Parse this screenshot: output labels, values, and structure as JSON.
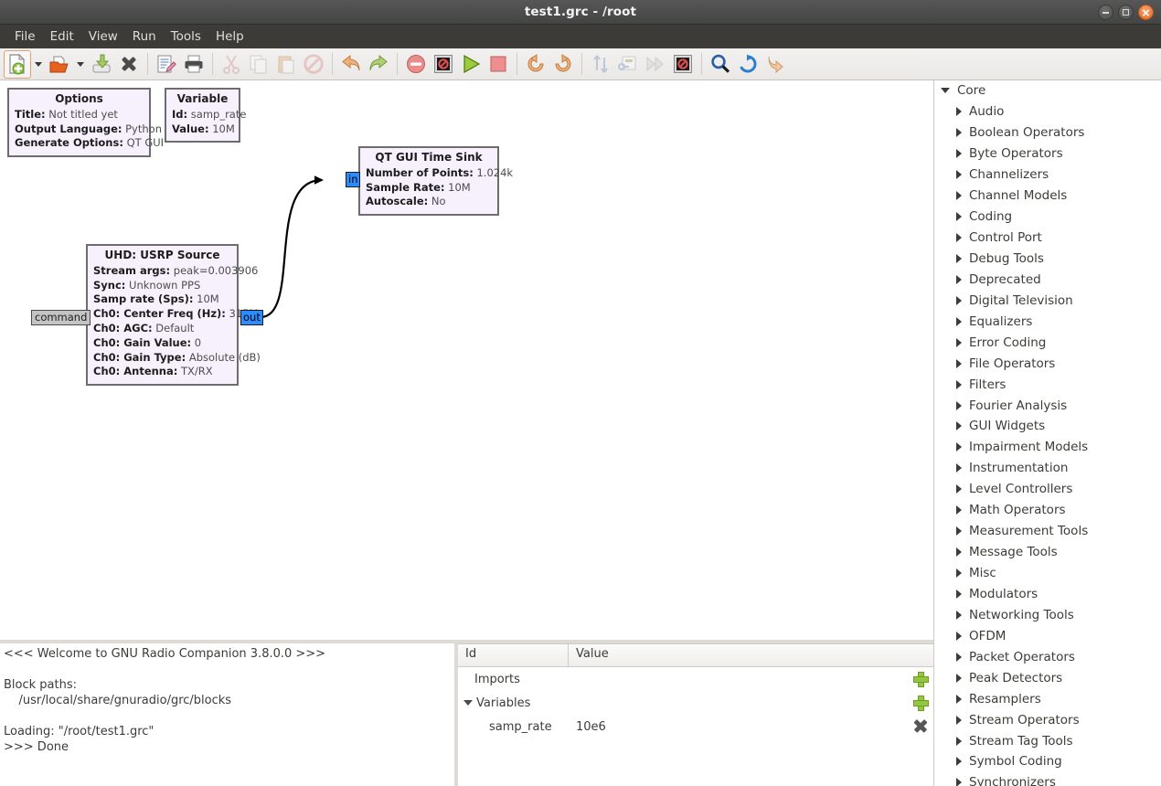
{
  "window": {
    "title": "test1.grc - /root",
    "controls": {
      "minimize": "minimize-button",
      "maximize": "maximize-button",
      "close": "close-button"
    }
  },
  "menubar": {
    "items": [
      "File",
      "Edit",
      "View",
      "Run",
      "Tools",
      "Help"
    ]
  },
  "toolbar": {
    "groups": [
      [
        {
          "name": "new-flowgraph",
          "icon": "new-document-icon",
          "selected": true,
          "enabled": true
        },
        {
          "name": "new-dropdown",
          "icon": "chevron-down-icon",
          "enabled": true
        },
        {
          "name": "open-flowgraph",
          "icon": "open-folder-icon",
          "enabled": true
        },
        {
          "name": "open-dropdown",
          "icon": "chevron-down-icon",
          "enabled": true
        },
        {
          "name": "save-flowgraph",
          "icon": "save-disk-icon",
          "enabled": true
        },
        {
          "name": "close-flowgraph",
          "icon": "close-x-icon",
          "enabled": true
        }
      ],
      [
        {
          "name": "edit-properties",
          "icon": "edit-pencil-icon",
          "enabled": true
        },
        {
          "name": "print",
          "icon": "printer-icon",
          "enabled": true
        }
      ],
      [
        {
          "name": "cut",
          "icon": "scissors-icon",
          "enabled": false
        },
        {
          "name": "copy",
          "icon": "copy-icon",
          "enabled": false
        },
        {
          "name": "paste",
          "icon": "paste-icon",
          "enabled": false
        },
        {
          "name": "delete",
          "icon": "no-entry-icon",
          "enabled": false
        }
      ],
      [
        {
          "name": "undo",
          "icon": "undo-arrow-icon",
          "enabled": true
        },
        {
          "name": "redo",
          "icon": "redo-arrow-icon",
          "enabled": true
        }
      ],
      [
        {
          "name": "errors",
          "icon": "error-circle-icon",
          "enabled": true
        },
        {
          "name": "generate",
          "icon": "generate-icon",
          "enabled": true
        },
        {
          "name": "execute-flowgraph",
          "icon": "play-icon",
          "enabled": true
        },
        {
          "name": "kill-flowgraph",
          "icon": "stop-square-icon",
          "enabled": true
        }
      ],
      [
        {
          "name": "rotate-left",
          "icon": "rotate-ccw-icon",
          "enabled": true
        },
        {
          "name": "rotate-right",
          "icon": "rotate-cw-icon",
          "enabled": true
        }
      ],
      [
        {
          "name": "toggle-source-sink",
          "icon": "updown-arrows-icon",
          "enabled": false
        },
        {
          "name": "enable-block",
          "icon": "enable-icon",
          "enabled": false
        },
        {
          "name": "bypass-block",
          "icon": "bypass-icon",
          "enabled": false
        },
        {
          "name": "disable-block",
          "icon": "disable-icon",
          "enabled": true
        }
      ],
      [
        {
          "name": "find-block",
          "icon": "magnifier-icon",
          "enabled": true
        },
        {
          "name": "reload-blocks",
          "icon": "reload-circle-icon",
          "enabled": true
        },
        {
          "name": "open-example",
          "icon": "download-arrow-icon",
          "enabled": true
        }
      ]
    ]
  },
  "canvas": {
    "blocks": [
      {
        "name": "options-block",
        "title": "Options",
        "params": [
          {
            "key": "Title:",
            "value": "Not titled yet"
          },
          {
            "key": "Output Language:",
            "value": "Python"
          },
          {
            "key": "Generate Options:",
            "value": "QT GUI"
          }
        ]
      },
      {
        "name": "variable-block",
        "title": "Variable",
        "params": [
          {
            "key": "Id:",
            "value": "samp_rate"
          },
          {
            "key": "Value:",
            "value": "10M"
          }
        ]
      },
      {
        "name": "qt-gui-time-sink-block",
        "title": "QT GUI Time Sink",
        "params": [
          {
            "key": "Number of Points:",
            "value": "1.024k"
          },
          {
            "key": "Sample Rate:",
            "value": "10M"
          },
          {
            "key": "Autoscale:",
            "value": "No"
          }
        ],
        "input_port": "in"
      },
      {
        "name": "uhd-usrp-source-block",
        "title": "UHD: USRP Source",
        "params": [
          {
            "key": "Stream args:",
            "value": "peak=0.003906"
          },
          {
            "key": "Sync:",
            "value": "Unknown PPS"
          },
          {
            "key": "Samp rate (Sps):",
            "value": "10M"
          },
          {
            "key": "Ch0: Center Freq (Hz):",
            "value": "315M"
          },
          {
            "key": "Ch0: AGC:",
            "value": "Default"
          },
          {
            "key": "Ch0: Gain Value:",
            "value": "0"
          },
          {
            "key": "Ch0: Gain Type:",
            "value": "Absolute (dB)"
          },
          {
            "key": "Ch0: Antenna:",
            "value": "TX/RX"
          }
        ],
        "message_port": "command",
        "output_port": "out"
      }
    ],
    "colors": {
      "block_fill": "#f7f1fe",
      "block_border": "#6d6d6d",
      "port_fill": "#2a8cff",
      "msg_port_fill": "#c4c4c4"
    }
  },
  "console": {
    "text": "<<< Welcome to GNU Radio Companion 3.8.0.0 >>>\n\nBlock paths:\n    /usr/local/share/gnuradio/grc/blocks\n\nLoading: \"/root/test1.grc\"\n>>> Done"
  },
  "variables_panel": {
    "columns": [
      "Id",
      "Value"
    ],
    "rows": [
      {
        "id": "Imports",
        "value": "",
        "indent": 0,
        "expandable": false,
        "action": "add"
      },
      {
        "id": "Variables",
        "value": "",
        "indent": 0,
        "expandable": true,
        "expanded": true,
        "action": "add"
      },
      {
        "id": "samp_rate",
        "value": "10e6",
        "indent": 1,
        "expandable": false,
        "action": "remove"
      }
    ]
  },
  "block_tree": {
    "root": {
      "label": "Core",
      "expanded": true
    },
    "items": [
      "Audio",
      "Boolean Operators",
      "Byte Operators",
      "Channelizers",
      "Channel Models",
      "Coding",
      "Control Port",
      "Debug Tools",
      "Deprecated",
      "Digital Television",
      "Equalizers",
      "Error Coding",
      "File Operators",
      "Filters",
      "Fourier Analysis",
      "GUI Widgets",
      "Impairment Models",
      "Instrumentation",
      "Level Controllers",
      "Math Operators",
      "Measurement Tools",
      "Message Tools",
      "Misc",
      "Modulators",
      "Networking Tools",
      "OFDM",
      "Packet Operators",
      "Peak Detectors",
      "Resamplers",
      "Stream Operators",
      "Stream Tag Tools",
      "Symbol Coding",
      "Synchronizers"
    ]
  }
}
